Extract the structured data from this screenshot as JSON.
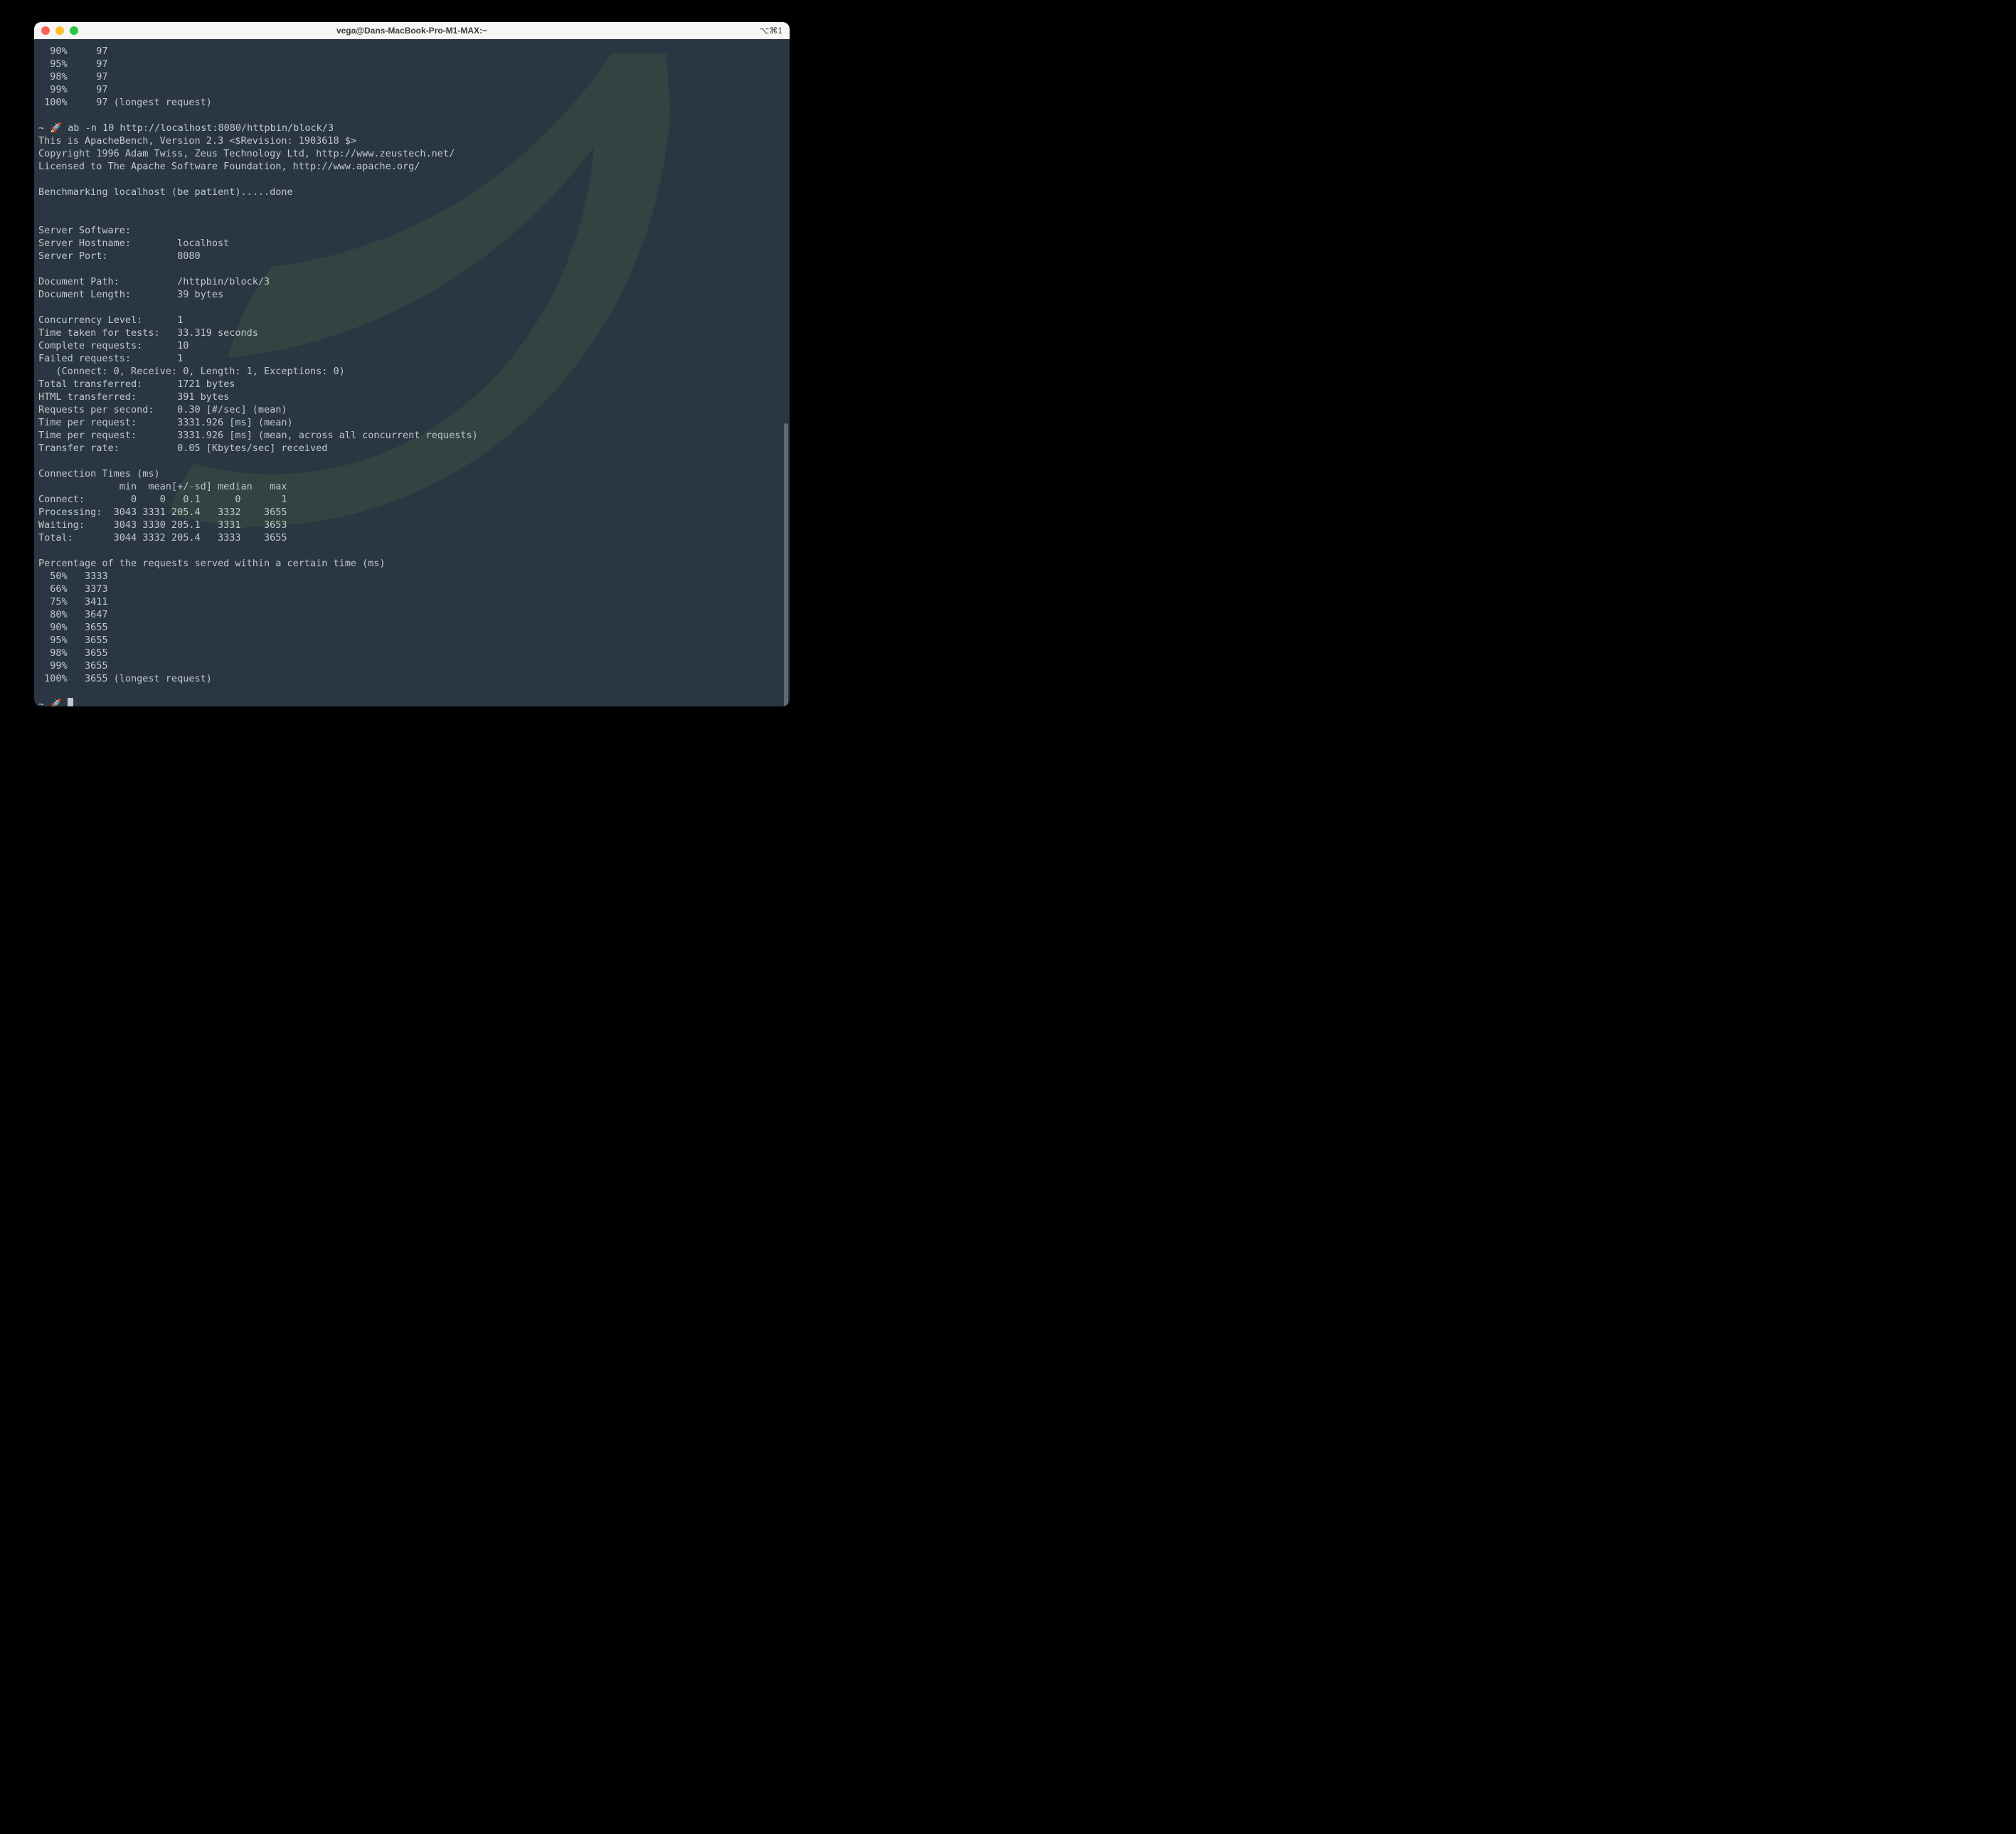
{
  "window": {
    "title": "vega@Dans-MacBook-Pro-M1-MAX:~",
    "shortcut": "⌥⌘1"
  },
  "prompt": {
    "symbol": "~ 🚀",
    "command": "ab -n 10 http://localhost:8080/httpbin/block/3"
  },
  "prev_percentiles": [
    {
      "pct": "90%",
      "val": "97"
    },
    {
      "pct": "95%",
      "val": "97"
    },
    {
      "pct": "98%",
      "val": "97"
    },
    {
      "pct": "99%",
      "val": "97"
    },
    {
      "pct": "100%",
      "val": "97",
      "suffix": " (longest request)"
    }
  ],
  "header": {
    "version": "This is ApacheBench, Version 2.3 <$Revision: 1903618 $>",
    "copyright": "Copyright 1996 Adam Twiss, Zeus Technology Ltd, http://www.zeustech.net/",
    "license": "Licensed to The Apache Software Foundation, http://www.apache.org/"
  },
  "benchmark_line": "Benchmarking localhost (be patient).....done",
  "server": {
    "software_label": "Server Software:",
    "software_value": "",
    "hostname_label": "Server Hostname:",
    "hostname_value": "localhost",
    "port_label": "Server Port:",
    "port_value": "8080"
  },
  "document": {
    "path_label": "Document Path:",
    "path_value": "/httpbin/block/3",
    "length_label": "Document Length:",
    "length_value": "39 bytes"
  },
  "stats": {
    "concurrency_label": "Concurrency Level:",
    "concurrency_value": "1",
    "time_label": "Time taken for tests:",
    "time_value": "33.319 seconds",
    "complete_label": "Complete requests:",
    "complete_value": "10",
    "failed_label": "Failed requests:",
    "failed_value": "1",
    "failed_detail": "   (Connect: 0, Receive: 0, Length: 1, Exceptions: 0)",
    "total_tx_label": "Total transferred:",
    "total_tx_value": "1721 bytes",
    "html_tx_label": "HTML transferred:",
    "html_tx_value": "391 bytes",
    "rps_label": "Requests per second:",
    "rps_value": "0.30 [#/sec] (mean)",
    "tpr1_label": "Time per request:",
    "tpr1_value": "3331.926 [ms] (mean)",
    "tpr2_label": "Time per request:",
    "tpr2_value": "3331.926 [ms] (mean, across all concurrent requests)",
    "rate_label": "Transfer rate:",
    "rate_value": "0.05 [Kbytes/sec] received"
  },
  "conn_times": {
    "title": "Connection Times (ms)",
    "header": "              min  mean[+/-sd] median   max",
    "rows": [
      {
        "name": "Connect:",
        "min": "0",
        "mean": "0",
        "sd": "0.1",
        "median": "0",
        "max": "1"
      },
      {
        "name": "Processing:",
        "min": "3043",
        "mean": "3331",
        "sd": "205.4",
        "median": "3332",
        "max": "3655"
      },
      {
        "name": "Waiting:",
        "min": "3043",
        "mean": "3330",
        "sd": "205.1",
        "median": "3331",
        "max": "3653"
      },
      {
        "name": "Total:",
        "min": "3044",
        "mean": "3332",
        "sd": "205.4",
        "median": "3333",
        "max": "3655"
      }
    ]
  },
  "percentile_title": "Percentage of the requests served within a certain time (ms)",
  "percentiles": [
    {
      "pct": "50%",
      "val": "3333"
    },
    {
      "pct": "66%",
      "val": "3373"
    },
    {
      "pct": "75%",
      "val": "3411"
    },
    {
      "pct": "80%",
      "val": "3647"
    },
    {
      "pct": "90%",
      "val": "3655"
    },
    {
      "pct": "95%",
      "val": "3655"
    },
    {
      "pct": "98%",
      "val": "3655"
    },
    {
      "pct": "99%",
      "val": "3655"
    },
    {
      "pct": "100%",
      "val": "3655",
      "suffix": " (longest request)"
    }
  ],
  "final_prompt": "~ 🚀 "
}
